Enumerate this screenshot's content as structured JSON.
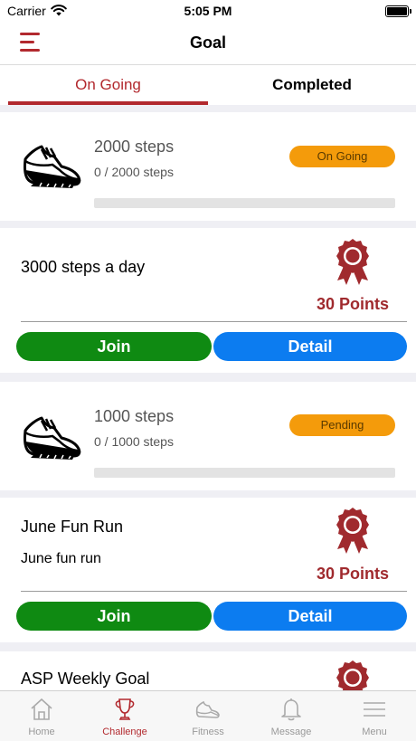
{
  "status_bar": {
    "carrier": "Carrier",
    "time": "5:05 PM"
  },
  "header": {
    "title": "Goal"
  },
  "tabs": [
    {
      "label": "On Going",
      "active": true
    },
    {
      "label": "Completed",
      "active": false
    }
  ],
  "goals": [
    {
      "title": "2000 steps",
      "progress_text": "0 / 2000 steps",
      "status": "On Going",
      "progress": 0
    },
    {
      "title": "1000 steps",
      "progress_text": "0 / 1000 steps",
      "status": "Pending",
      "progress": 0
    }
  ],
  "challenges": [
    {
      "name": "3000 steps a day",
      "description": "",
      "points": "30 Points",
      "join_label": "Join",
      "detail_label": "Detail"
    },
    {
      "name": "June Fun Run",
      "description": "June fun run",
      "points": "30 Points",
      "join_label": "Join",
      "detail_label": "Detail"
    },
    {
      "name": "ASP Weekly Goal",
      "description": "",
      "points": ""
    }
  ],
  "bottom_nav": [
    {
      "label": "Home",
      "icon": "home-icon",
      "active": false
    },
    {
      "label": "Challenge",
      "icon": "trophy-icon",
      "active": true
    },
    {
      "label": "Fitness",
      "icon": "shoe-icon",
      "active": false
    },
    {
      "label": "Message",
      "icon": "bell-icon",
      "active": false
    },
    {
      "label": "Menu",
      "icon": "menu-icon",
      "active": false
    }
  ],
  "colors": {
    "accent": "#b2292e",
    "status_pill": "#f49b0b",
    "join": "#0f8a12",
    "detail": "#0c7cf0"
  }
}
